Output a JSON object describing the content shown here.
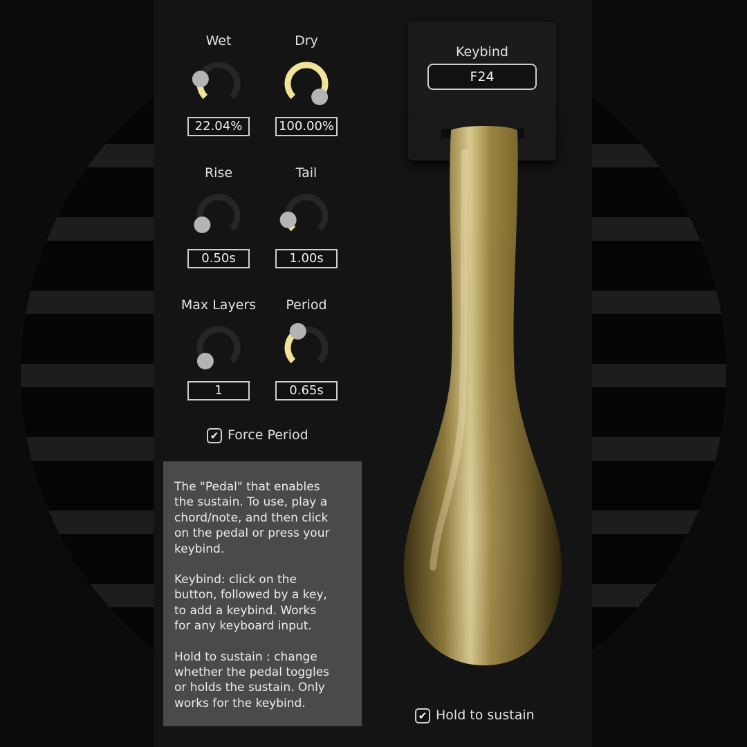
{
  "knobs": [
    {
      "id": "wet",
      "label": "Wet",
      "value": "22.04%",
      "level": 0.2204
    },
    {
      "id": "dry",
      "label": "Dry",
      "value": "100.00%",
      "level": 1.0
    },
    {
      "id": "rise",
      "label": "Rise",
      "value": "0.50s",
      "level": 0.06
    },
    {
      "id": "tail",
      "label": "Tail",
      "value": "1.00s",
      "level": 0.12
    },
    {
      "id": "max-layers",
      "label": "Max Layers",
      "value": "1",
      "level": 0.0
    },
    {
      "id": "period",
      "label": "Period",
      "value": "0.65s",
      "level": 0.4
    }
  ],
  "force_period": {
    "label": "Force Period",
    "checked": true
  },
  "keybind": {
    "label": "Keybind",
    "value": "F24"
  },
  "help": {
    "p1": "The \"Pedal\" that enables\nthe sustain. To use, play a\nchord/note, and then click\non the pedal or press your\nkeybind.",
    "p2": "Keybind: click on the\nbutton, followed by a key,\nto add a keybind. Works\nfor any keyboard input.",
    "p3": "Hold to sustain : change\nwhether the pedal toggles\nor holds the sustain. Only\nworks for the keybind."
  },
  "hold_to_sustain": {
    "label": "Hold to sustain",
    "checked": true
  },
  "colors": {
    "accent": "#f2e39a",
    "knob_track": "#262626",
    "knob_thumb": "#b4b4b4",
    "pedal_gold": "#8a7433"
  },
  "icons": {
    "checkmark": "✔"
  }
}
